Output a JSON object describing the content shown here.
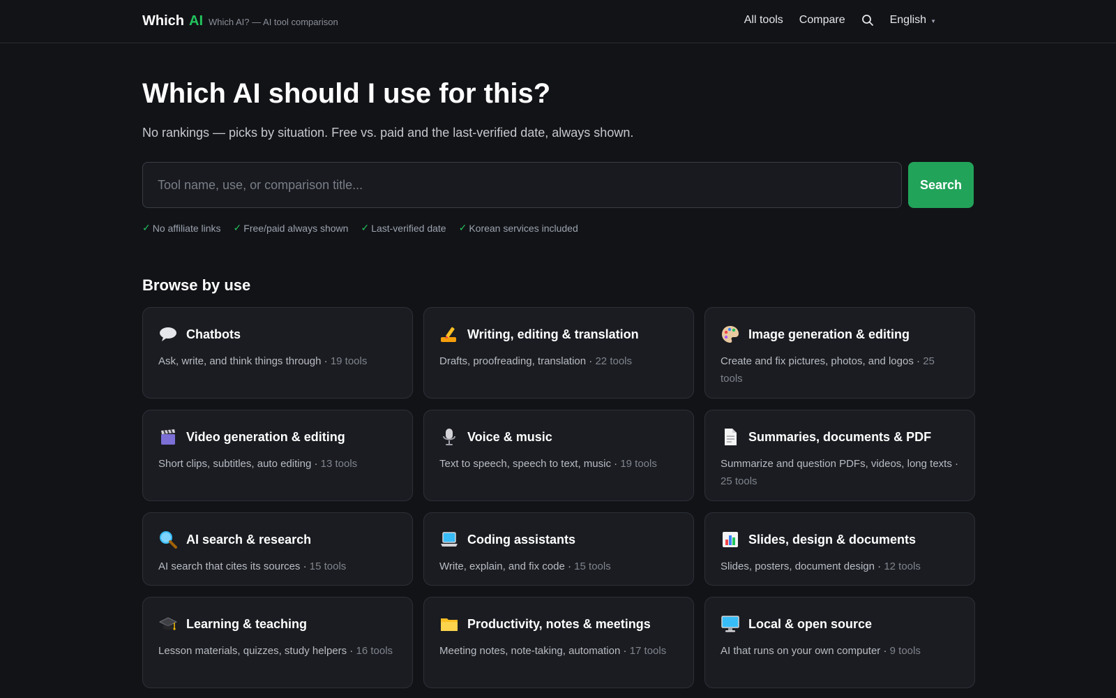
{
  "header": {
    "brand_word": "Which",
    "brand_accent": "AI",
    "tagline": "Which AI? — AI tool comparison",
    "nav": {
      "all_tools": "All tools",
      "compare": "Compare",
      "language": "English"
    }
  },
  "hero": {
    "title": "Which AI should I use for this?",
    "subtitle": "No rankings — picks by situation. Free vs. paid and the last-verified date, always shown."
  },
  "search": {
    "placeholder": "Tool name, use, or comparison title...",
    "button_label": "Search"
  },
  "features": [
    "No affiliate links",
    "Free/paid always shown",
    "Last-verified date",
    "Korean services included"
  ],
  "browse": {
    "title": "Browse by use",
    "categories": [
      {
        "icon": "speech-bubble-icon",
        "title": "Chatbots",
        "description": "Ask, write, and think things through",
        "count": "19 tools"
      },
      {
        "icon": "writing-hand-icon",
        "title": "Writing, editing & translation",
        "description": "Drafts, proofreading, translation",
        "count": "22 tools"
      },
      {
        "icon": "palette-icon",
        "title": "Image generation & editing",
        "description": "Create and fix pictures, photos, and logos",
        "count": "25 tools"
      },
      {
        "icon": "clapper-board-icon",
        "title": "Video generation & editing",
        "description": "Short clips, subtitles, auto editing",
        "count": "13 tools"
      },
      {
        "icon": "microphone-icon",
        "title": "Voice & music",
        "description": "Text to speech, speech to text, music",
        "count": "19 tools"
      },
      {
        "icon": "document-icon",
        "title": "Summaries, documents & PDF",
        "description": "Summarize and question PDFs, videos, long texts",
        "count": "25 tools"
      },
      {
        "icon": "magnifier-icon",
        "title": "AI search & research",
        "description": "AI search that cites its sources",
        "count": "15 tools"
      },
      {
        "icon": "laptop-icon",
        "title": "Coding assistants",
        "description": "Write, explain, and fix code",
        "count": "15 tools"
      },
      {
        "icon": "bar-chart-icon",
        "title": "Slides, design & documents",
        "description": "Slides, posters, document design",
        "count": "12 tools"
      },
      {
        "icon": "graduation-cap-icon",
        "title": "Learning & teaching",
        "description": "Lesson materials, quizzes, study helpers",
        "count": "16 tools"
      },
      {
        "icon": "folder-icon",
        "title": "Productivity, notes & meetings",
        "description": "Meeting notes, note-taking, automation",
        "count": "17 tools"
      },
      {
        "icon": "desktop-computer-icon",
        "title": "Local & open source",
        "description": "AI that runs on your own computer",
        "count": "9 tools"
      }
    ]
  },
  "colors": {
    "background": "#121317",
    "accent": "#22c55e",
    "search_button": "#22a35a",
    "card_background": "#1a1c21",
    "card_border": "#2d3038"
  }
}
